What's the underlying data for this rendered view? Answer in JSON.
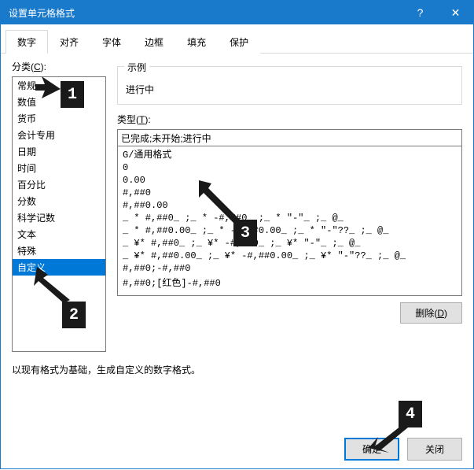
{
  "titlebar": {
    "title": "设置单元格格式"
  },
  "tabs": [
    "数字",
    "对齐",
    "字体",
    "边框",
    "填充",
    "保护"
  ],
  "active_tab_index": 0,
  "left": {
    "label": "分类(C):",
    "categories": [
      "常规",
      "数值",
      "货币",
      "会计专用",
      "日期",
      "时间",
      "百分比",
      "分数",
      "科学记数",
      "文本",
      "特殊",
      "自定义"
    ],
    "selected_index": 11
  },
  "right": {
    "sample_label": "示例",
    "sample_value": "进行中",
    "type_label": "类型(T):",
    "type_value": "已完成;未开始;进行中",
    "formats": [
      "G/通用格式",
      "0",
      "0.00",
      "#,##0",
      "#,##0.00",
      "_ * #,##0_ ;_ * -#,##0_ ;_ * \"-\"_ ;_ @_ ",
      "_ * #,##0.00_ ;_ * -#,##0.00_ ;_ * \"-\"??_ ;_ @_ ",
      "_ ¥* #,##0_ ;_ ¥* -#,##0_ ;_ ¥* \"-\"_ ;_ @_ ",
      "_ ¥* #,##0.00_ ;_ ¥* -#,##0.00_ ;_ ¥* \"-\"??_ ;_ @_ ",
      "#,##0;-#,##0",
      "#,##0;[红色]-#,##0"
    ],
    "delete_label": "删除(D)"
  },
  "hint": "以现有格式为基础，生成自定义的数字格式。",
  "footer": {
    "ok": "确定",
    "close": "关闭"
  },
  "callouts": {
    "c1": "1",
    "c2": "2",
    "c3": "3",
    "c4": "4"
  }
}
